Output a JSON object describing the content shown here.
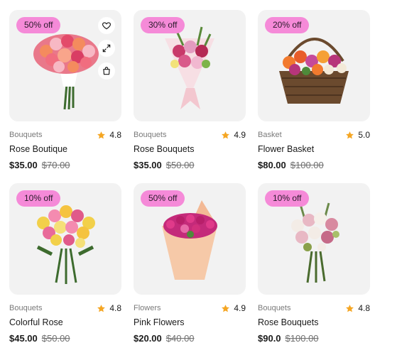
{
  "colors": {
    "badge": "#f58ad8",
    "star": "#f5a623",
    "card_bg": "#f2f2f2"
  },
  "actions": [
    {
      "icon": "heart-icon"
    },
    {
      "icon": "expand-icon"
    },
    {
      "icon": "shopping-bag-icon"
    }
  ],
  "products": [
    {
      "badge": "50% off",
      "category": "Bouquets",
      "rating": "4.8",
      "name": "Rose Boutique",
      "price": "$35.00",
      "old_price": "$70.00",
      "image": "rose-bouquet"
    },
    {
      "badge": "30% off",
      "category": "Bouquets",
      "rating": "4.9",
      "name": "Rose Bouquets",
      "price": "$35.00",
      "old_price": "$50.00",
      "image": "pink-wrapped-bouquet"
    },
    {
      "badge": "20% off",
      "category": "Basket",
      "rating": "5.0",
      "name": "Flower Basket",
      "price": "$80.00",
      "old_price": "$100.00",
      "image": "flower-basket"
    },
    {
      "badge": "10% off",
      "category": "Bouquets",
      "rating": "4.8",
      "name": "Colorful Rose",
      "price": "$45.00",
      "old_price": "$50.00",
      "image": "colorful-rose-bouquet"
    },
    {
      "badge": "50% off",
      "category": "Flowers",
      "rating": "4.9",
      "name": "Pink Flowers",
      "price": "$20.00",
      "old_price": "$40.00",
      "image": "pink-flowers-cone"
    },
    {
      "badge": "10% off",
      "category": "Bouquets",
      "rating": "4.8",
      "name": "Rose Bouquets",
      "price": "$90.0",
      "old_price": "$100.00",
      "image": "white-pink-bouquet"
    }
  ]
}
